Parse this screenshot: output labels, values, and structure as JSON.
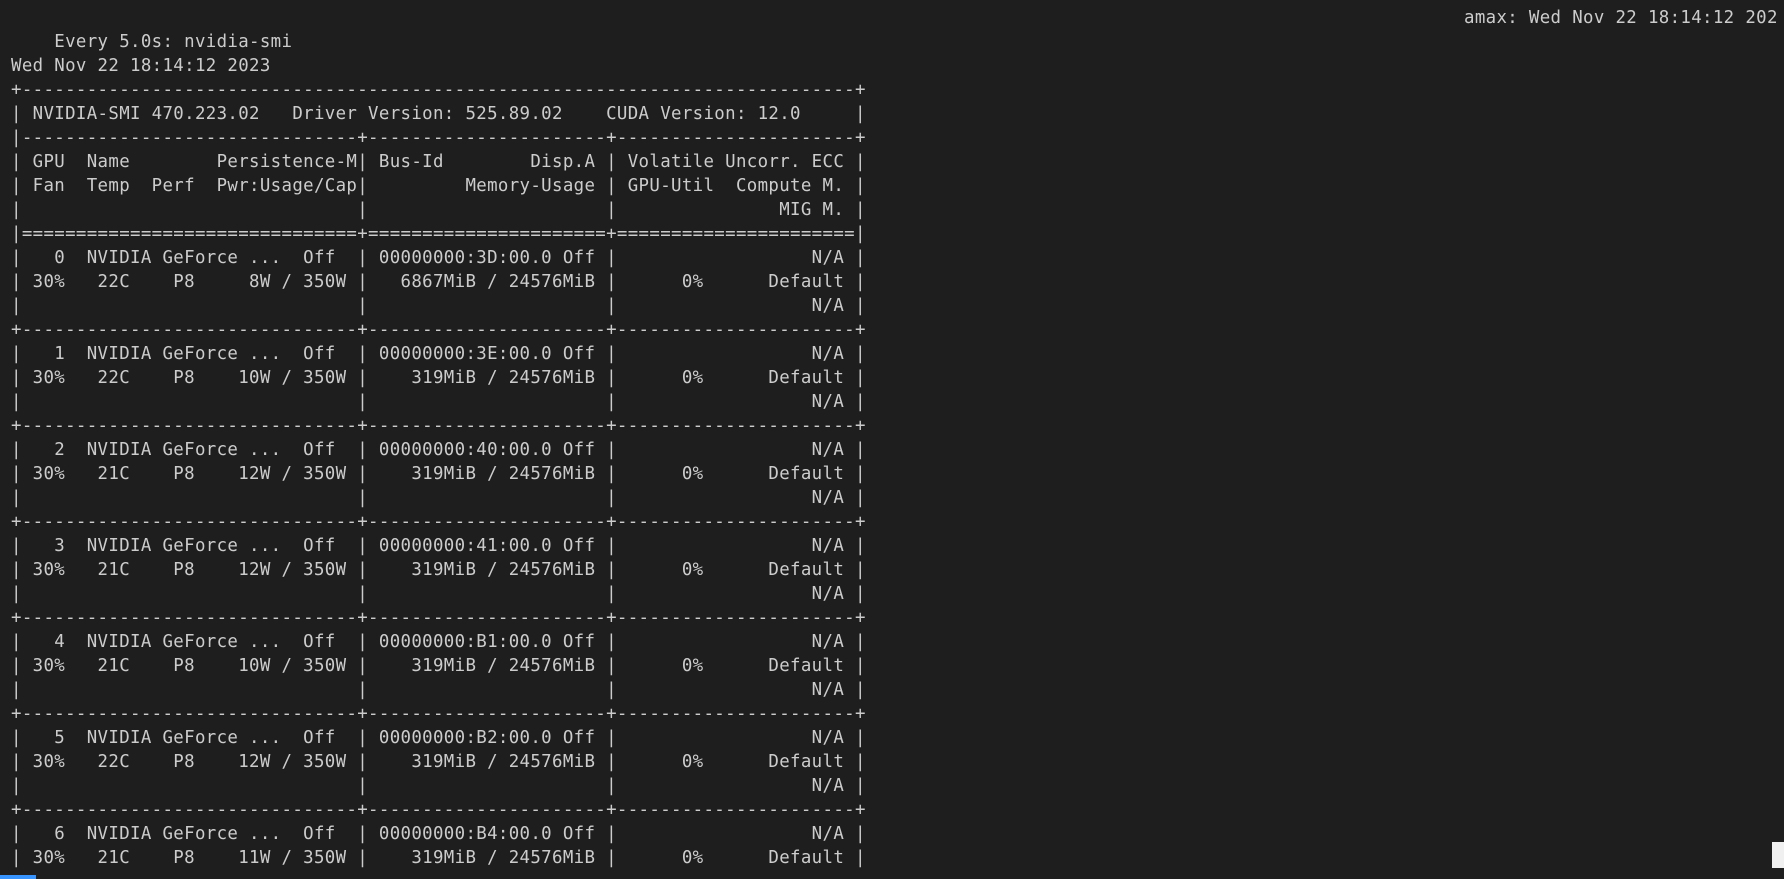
{
  "terminal": {
    "header_left": "Every 5.0s: nvidia-smi",
    "header_right": "amax: Wed Nov 22 18:14:12 202",
    "blank": "",
    "date_line": "Wed Nov 22 18:14:12 2023",
    "lines": [
      "+-----------------------------------------------------------------------------+",
      "| NVIDIA-SMI 470.223.02   Driver Version: 525.89.02    CUDA Version: 12.0     |",
      "|-------------------------------+----------------------+----------------------+",
      "| GPU  Name        Persistence-M| Bus-Id        Disp.A | Volatile Uncorr. ECC |",
      "| Fan  Temp  Perf  Pwr:Usage/Cap|         Memory-Usage | GPU-Util  Compute M. |",
      "|                               |                      |               MIG M. |",
      "|===============================+======================+======================|",
      "|   0  NVIDIA GeForce ...  Off  | 00000000:3D:00.0 Off |                  N/A |",
      "| 30%   22C    P8     8W / 350W |   6867MiB / 24576MiB |      0%      Default |",
      "|                               |                      |                  N/A |",
      "+-------------------------------+----------------------+----------------------+",
      "|   1  NVIDIA GeForce ...  Off  | 00000000:3E:00.0 Off |                  N/A |",
      "| 30%   22C    P8    10W / 350W |    319MiB / 24576MiB |      0%      Default |",
      "|                               |                      |                  N/A |",
      "+-------------------------------+----------------------+----------------------+",
      "|   2  NVIDIA GeForce ...  Off  | 00000000:40:00.0 Off |                  N/A |",
      "| 30%   21C    P8    12W / 350W |    319MiB / 24576MiB |      0%      Default |",
      "|                               |                      |                  N/A |",
      "+-------------------------------+----------------------+----------------------+",
      "|   3  NVIDIA GeForce ...  Off  | 00000000:41:00.0 Off |                  N/A |",
      "| 30%   21C    P8    12W / 350W |    319MiB / 24576MiB |      0%      Default |",
      "|                               |                      |                  N/A |",
      "+-------------------------------+----------------------+----------------------+",
      "|   4  NVIDIA GeForce ...  Off  | 00000000:B1:00.0 Off |                  N/A |",
      "| 30%   21C    P8    10W / 350W |    319MiB / 24576MiB |      0%      Default |",
      "|                               |                      |                  N/A |",
      "+-------------------------------+----------------------+----------------------+",
      "|   5  NVIDIA GeForce ...  Off  | 00000000:B2:00.0 Off |                  N/A |",
      "| 30%   22C    P8    12W / 350W |    319MiB / 24576MiB |      0%      Default |",
      "|                               |                      |                  N/A |",
      "+-------------------------------+----------------------+----------------------+",
      "|   6  NVIDIA GeForce ...  Off  | 00000000:B4:00.0 Off |                  N/A |",
      "| 30%   21C    P8    11W / 350W |    319MiB / 24576MiB |      0%      Default |"
    ]
  }
}
